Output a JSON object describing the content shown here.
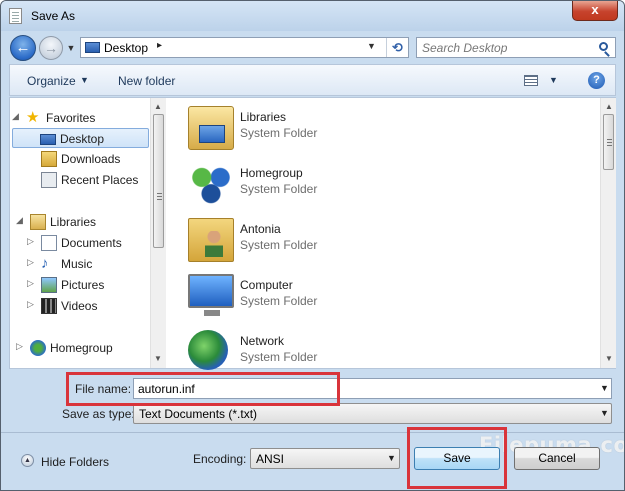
{
  "window": {
    "title": "Save As",
    "close_glyph": "x"
  },
  "address_bar": {
    "path_text": "Desktop",
    "crumb_arrow": "▸",
    "dropdown_glyph": "▼",
    "refresh_glyph": "⟲",
    "back_glyph": "←",
    "forward_glyph": "→",
    "history_glyph": "▼"
  },
  "search": {
    "placeholder": "Search Desktop"
  },
  "toolbar": {
    "organize_label": "Organize",
    "organize_caret": "▼",
    "new_folder_label": "New folder",
    "views_caret": "▼",
    "help_glyph": "?"
  },
  "navigation": {
    "items": [
      {
        "label": "Favorites",
        "expander": "◢"
      },
      {
        "label": "Desktop"
      },
      {
        "label": "Downloads"
      },
      {
        "label": "Recent Places"
      },
      {
        "label": "Libraries",
        "expander": "◢"
      },
      {
        "label": "Documents",
        "expander": "▷"
      },
      {
        "label": "Music",
        "expander": "▷"
      },
      {
        "label": "Pictures",
        "expander": "▷"
      },
      {
        "label": "Videos",
        "expander": "▷"
      },
      {
        "label": "Homegroup",
        "expander": "▷"
      }
    ],
    "selected": "Desktop",
    "scroll_up": "▲",
    "scroll_down": "▼"
  },
  "files": {
    "items": [
      {
        "name": "Libraries",
        "type": "System Folder",
        "icon": "libraries-icon"
      },
      {
        "name": "Homegroup",
        "type": "System Folder",
        "icon": "homegroup-icon"
      },
      {
        "name": "Antonia",
        "type": "System Folder",
        "icon": "user-folder-icon"
      },
      {
        "name": "Computer",
        "type": "System Folder",
        "icon": "computer-icon"
      },
      {
        "name": "Network",
        "type": "System Folder",
        "icon": "network-icon"
      }
    ],
    "scroll_up": "▲",
    "scroll_down": "▼"
  },
  "form": {
    "file_name_label": "File name:",
    "file_name_value": "autorun.inf",
    "save_as_type_label": "Save as type:",
    "save_as_type_value": "Text Documents (*.txt)",
    "dropdown_glyph": "▼",
    "encoding_label": "Encoding:",
    "encoding_value": "ANSI"
  },
  "footer": {
    "hide_folders_label": "Hide Folders",
    "hide_folders_glyph": "▲",
    "save_label": "Save",
    "cancel_label": "Cancel"
  },
  "watermark": {
    "text": "Filepuma.com"
  },
  "colors": {
    "highlight": "#d9343b",
    "selection_border": "#84acdd",
    "default_button_border": "#3c7fb1"
  }
}
